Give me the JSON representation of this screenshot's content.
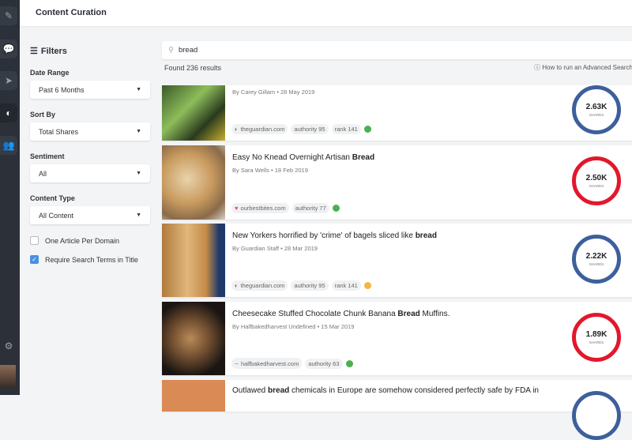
{
  "header": {
    "title": "Content Curation"
  },
  "filters": {
    "title": "Filters",
    "date_range": {
      "label": "Date Range",
      "value": "Past 6 Months"
    },
    "sort_by": {
      "label": "Sort By",
      "value": "Total Shares"
    },
    "sentiment": {
      "label": "Sentiment",
      "value": "All"
    },
    "content_type": {
      "label": "Content Type",
      "value": "All Content"
    },
    "one_per_domain": {
      "label": "One Article Per Domain",
      "checked": false
    },
    "require_terms": {
      "label": "Require Search Terms in Title",
      "checked": true
    }
  },
  "search": {
    "value": "bread",
    "results": "Found 236 results",
    "advanced": "How to run an Advanced Search"
  },
  "results": [
    {
      "title_pre": "",
      "title_bold": "",
      "title_post": "",
      "byline": "By Carey Gillam • 28 May 2019",
      "domain": "theguardian.com",
      "authority": "authority 95",
      "rank": "rank 141",
      "status_color": "#4caf50",
      "shares": "2.63K",
      "shares_label": "SHARES",
      "ring_color": "#3d5f9c"
    },
    {
      "title_pre": "Easy No Knead Overnight Artisan ",
      "title_bold": "Bread",
      "title_post": "",
      "byline": "By Sara Wells • 18 Feb 2019",
      "domain": "ourbestbites.com",
      "authority": "authority 77",
      "status_color": "#4caf50",
      "shares": "2.50K",
      "shares_label": "SHARES",
      "ring_color": "#e3172c"
    },
    {
      "title_pre": "New Yorkers horrified by 'crime' of bagels sliced like ",
      "title_bold": "bread",
      "title_post": "",
      "byline": "By Guardian Staff • 28 Mar 2019",
      "domain": "theguardian.com",
      "authority": "authority 95",
      "rank": "rank 141",
      "status_color": "#f4b63f",
      "shares": "2.22K",
      "shares_label": "SHARES",
      "ring_color": "#3d5f9c"
    },
    {
      "title_pre": "Cheesecake Stuffed Chocolate Chunk Banana ",
      "title_bold": "Bread",
      "title_post": " Muffins.",
      "byline": "By Halfbakedharvest Undefined • 15 Mar 2019",
      "domain": "halfbakedharvest.com",
      "authority": "authority 63",
      "status_color": "#4caf50",
      "shares": "1.89K",
      "shares_label": "SHARES",
      "ring_color": "#e3172c"
    },
    {
      "title_pre": "Outlawed ",
      "title_bold": "bread",
      "title_post": " chemicals in Europe are somehow considered perfectly safe by FDA in"
    }
  ]
}
